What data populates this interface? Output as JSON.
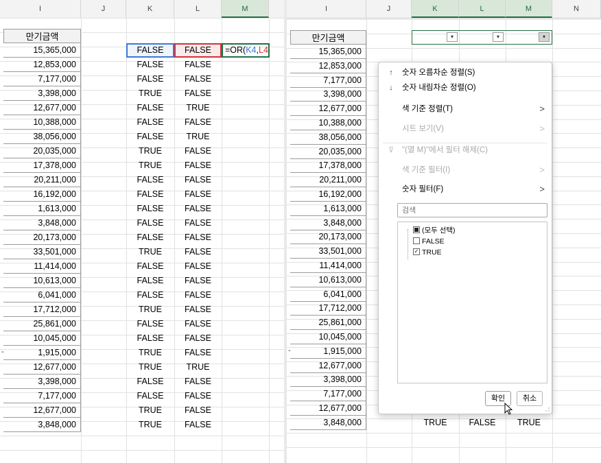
{
  "left_pane": {
    "columns": [
      "I",
      "J",
      "K",
      "L",
      "M"
    ],
    "header_label": "만기금액",
    "amounts": [
      "15,365,000",
      "12,853,000",
      "7,177,000",
      "3,398,000",
      "12,677,000",
      "10,388,000",
      "38,056,000",
      "20,035,000",
      "17,378,000",
      "20,211,000",
      "16,192,000",
      "1,613,000",
      "3,848,000",
      "20,173,000",
      "33,501,000",
      "11,414,000",
      "10,613,000",
      "6,041,000",
      "17,712,000",
      "25,861,000",
      "10,045,000",
      "1,915,000",
      "12,677,000",
      "3,398,000",
      "7,177,000",
      "12,677,000",
      "3,848,000"
    ],
    "k_values": [
      "FALSE",
      "FALSE",
      "FALSE",
      "TRUE",
      "FALSE",
      "FALSE",
      "FALSE",
      "TRUE",
      "TRUE",
      "FALSE",
      "FALSE",
      "FALSE",
      "FALSE",
      "FALSE",
      "TRUE",
      "FALSE",
      "FALSE",
      "FALSE",
      "TRUE",
      "FALSE",
      "FALSE",
      "TRUE",
      "TRUE",
      "FALSE",
      "FALSE",
      "TRUE",
      "TRUE"
    ],
    "l_values": [
      "FALSE",
      "FALSE",
      "FALSE",
      "FALSE",
      "TRUE",
      "FALSE",
      "TRUE",
      "FALSE",
      "FALSE",
      "FALSE",
      "FALSE",
      "FALSE",
      "FALSE",
      "FALSE",
      "FALSE",
      "FALSE",
      "FALSE",
      "FALSE",
      "FALSE",
      "FALSE",
      "FALSE",
      "FALSE",
      "TRUE",
      "FALSE",
      "FALSE",
      "FALSE",
      "FALSE"
    ],
    "formula": {
      "prefix": "=OR(",
      "ref1": "K4",
      "comma": ",",
      "ref2": "L4",
      "suffix": ")"
    },
    "dash_marker": "-"
  },
  "right_pane": {
    "columns": [
      "I",
      "J",
      "K",
      "L",
      "M",
      "N"
    ],
    "header_label": "만기금액",
    "amounts": [
      "15,365,000",
      "12,853,000",
      "7,177,000",
      "3,398,000",
      "12,677,000",
      "10,388,000",
      "38,056,000",
      "20,035,000",
      "17,378,000",
      "20,211,000",
      "16,192,000",
      "1,613,000",
      "3,848,000",
      "20,173,000",
      "33,501,000",
      "11,414,000",
      "10,613,000",
      "6,041,000",
      "17,712,000",
      "25,861,000",
      "10,045,000",
      "1,915,000",
      "12,677,000",
      "3,398,000",
      "7,177,000",
      "12,677,000",
      "3,848,000"
    ],
    "bottom_rows": [
      {
        "k": "TRUE",
        "l": "FALSE",
        "m": "TRUE"
      },
      {
        "k": "TRUE",
        "l": "FALSE",
        "m": "TRUE"
      }
    ],
    "filter_arrow": "▾",
    "dash_marker": "-"
  },
  "filter_menu": {
    "items": [
      {
        "icon": "↑",
        "label": "숫자 오름차순 정렬(S)",
        "arrow": "",
        "disabled": false,
        "icon_name": "sort-ascending-icon"
      },
      {
        "icon": "↓",
        "label": "숫자 내림차순 정렬(O)",
        "arrow": "",
        "disabled": false,
        "icon_name": "sort-descending-icon"
      },
      {
        "icon": "",
        "label": "색 기준 정렬(T)",
        "arrow": ">",
        "disabled": false,
        "icon_name": ""
      },
      {
        "icon": "",
        "label": "시트 보기(V)",
        "arrow": ">",
        "disabled": true,
        "icon_name": ""
      },
      {
        "icon": "⊽",
        "label": "\"(열 M)\"에서 필터 해제(C)",
        "arrow": "",
        "disabled": true,
        "icon_name": "clear-filter-icon"
      },
      {
        "icon": "",
        "label": "색 기준 필터(I)",
        "arrow": ">",
        "disabled": true,
        "icon_name": ""
      },
      {
        "icon": "",
        "label": "숫자 필터(F)",
        "arrow": ">",
        "disabled": false,
        "icon_name": ""
      }
    ],
    "search_placeholder": "검색",
    "values": [
      {
        "label": "(모두 선택)",
        "state": "indeterminate"
      },
      {
        "label": "FALSE",
        "state": "unchecked"
      },
      {
        "label": "TRUE",
        "state": "checked"
      }
    ],
    "ok_label": "확인",
    "cancel_label": "취소"
  }
}
